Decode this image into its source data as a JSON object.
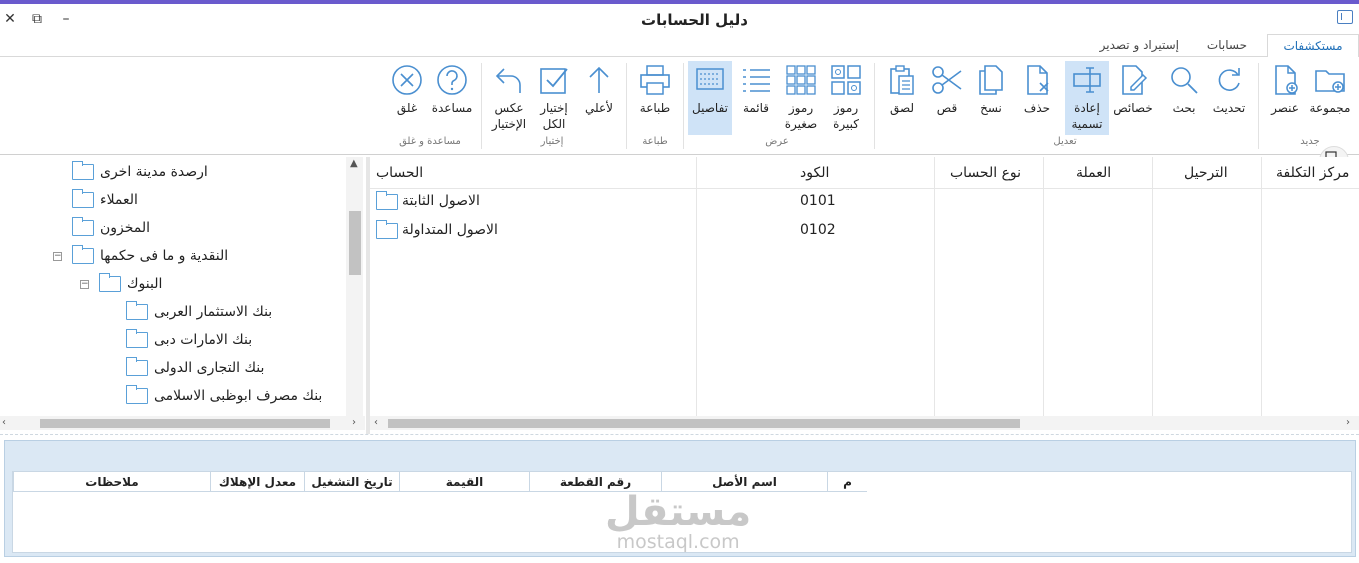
{
  "window": {
    "title": "دليل الحسابات",
    "close": "✕",
    "restore": "⧉",
    "minimize": "–"
  },
  "tabs": [
    {
      "label": "مستكشفات",
      "active": true
    },
    {
      "label": "حسابات",
      "active": false
    },
    {
      "label": "إستيراد و تصدير",
      "active": false
    }
  ],
  "ribbon": {
    "groups": {
      "new": "جديد",
      "edit": "تعديل",
      "view": "عرض",
      "print": "طباعة",
      "select": "إختيار",
      "help": "مساعدة و غلق"
    },
    "buttons": {
      "group": "مجموعة",
      "item": "عنصر",
      "refresh": "تحديث",
      "search": "بحث",
      "properties": "خصائص",
      "rename": "إعادة\nتسمية",
      "delete": "حذف",
      "copy": "نسخ",
      "cut": "قص",
      "paste": "لصق",
      "large_icons": "رموز\nكبيرة",
      "small_icons": "رموز\nصغيرة",
      "list": "قائمة",
      "details": "تفاصيل",
      "print": "طباعة",
      "up": "لأعلي",
      "select_all": "إختيار\nالكل",
      "invert_selection": "عكس\nالإختيار",
      "help": "مساعدة",
      "close": "غلق"
    }
  },
  "tree": {
    "items": [
      {
        "label": "ارصدة مدينة اخرى",
        "level": 0,
        "expander": ""
      },
      {
        "label": "العملاء",
        "level": 0,
        "expander": ""
      },
      {
        "label": "المخزون",
        "level": 0,
        "expander": ""
      },
      {
        "label": "النقدية و ما فى حكمها",
        "level": 0,
        "expander": "⊟"
      },
      {
        "label": "البنوك",
        "level": 1,
        "expander": "⊟"
      },
      {
        "label": "بنك الاستثمار العربى",
        "level": 2,
        "expander": ""
      },
      {
        "label": "بنك الامارات دبى",
        "level": 2,
        "expander": ""
      },
      {
        "label": "بنك التجارى الدولى",
        "level": 2,
        "expander": ""
      },
      {
        "label": "بنك مصرف ابوظبى الاسلامى",
        "level": 2,
        "expander": ""
      }
    ]
  },
  "grid": {
    "columns": [
      "الحساب",
      "الكود",
      "نوع الحساب",
      "العملة",
      "الترحيل",
      "مركز التكلفة"
    ],
    "rows": [
      {
        "account": "الاصول الثابتة",
        "code": "0101"
      },
      {
        "account": "الاصول المتداولة",
        "code": "0102"
      }
    ]
  },
  "assets_table": {
    "columns": [
      "م",
      "اسم الأصل",
      "رقم القطعة",
      "القيمة",
      "تاريخ التشغيل",
      "معدل الإهلاك",
      "ملاحظات"
    ]
  },
  "watermark": {
    "line1": "مستقل",
    "line2": "mostaql.com"
  },
  "colors": {
    "accent": "#1e6fb8",
    "icon": "#4a8fd0",
    "selected": "#cfe3f7",
    "topline": "#6a5acd"
  }
}
